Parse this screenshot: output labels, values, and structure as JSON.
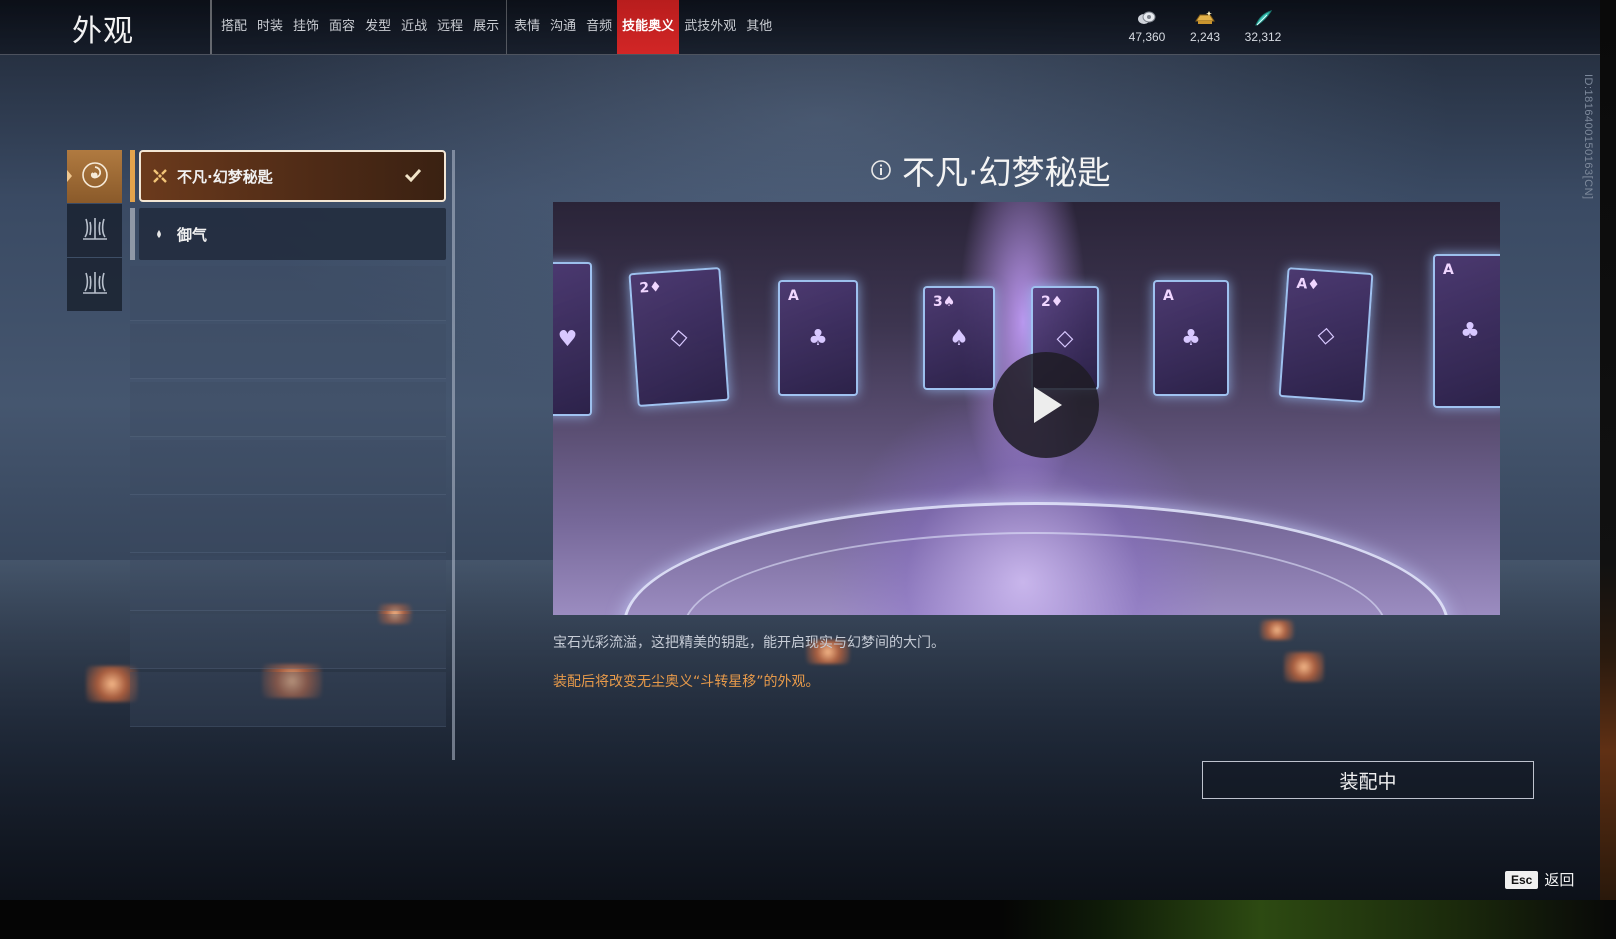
{
  "header": {
    "title": "外观",
    "tabs": [
      {
        "label": "搭配"
      },
      {
        "label": "时装"
      },
      {
        "label": "挂饰"
      },
      {
        "label": "面容"
      },
      {
        "label": "发型"
      },
      {
        "label": "近战"
      },
      {
        "label": "远程"
      },
      {
        "label": "展示"
      },
      {
        "label": "表情"
      },
      {
        "label": "沟通"
      },
      {
        "label": "音频"
      },
      {
        "label": "技能奥义"
      },
      {
        "label": "武技外观"
      },
      {
        "label": "其他"
      }
    ],
    "active_tab": "技能奥义",
    "currencies": [
      {
        "icon": "coin-stack-icon",
        "value": "47,360"
      },
      {
        "icon": "gold-ingot-icon",
        "value": "2,243"
      },
      {
        "icon": "jade-feather-icon",
        "value": "32,312"
      }
    ]
  },
  "uid": "ID:1816400150163[CN]",
  "categories": [
    {
      "icon": "swirl-emblem-icon",
      "active": true
    },
    {
      "icon": "trident-crown-icon",
      "active": false
    },
    {
      "icon": "trident-crown-icon",
      "active": false
    }
  ],
  "list": {
    "items": [
      {
        "label": "不凡·幻梦秘匙",
        "icon": "rarity-star-icon",
        "selected": true,
        "equipped": true
      },
      {
        "label": "御气",
        "icon": "dot-icon",
        "selected": false,
        "equipped": false
      }
    ]
  },
  "detail": {
    "title": "不凡·幻梦秘匙",
    "description": "宝石光彩流溢，这把精美的钥匙，能开启现实与幻梦间的大门。",
    "effect": "装配后将改变无尘奥义“斗转星移”的外观。",
    "equip_button": "装配中"
  },
  "footer": {
    "esc_key": "Esc",
    "esc_label": "返回"
  },
  "colors": {
    "active_tab": "#d22626",
    "selection_accent": "#e3a34c",
    "effect_text": "#e79a4a"
  }
}
